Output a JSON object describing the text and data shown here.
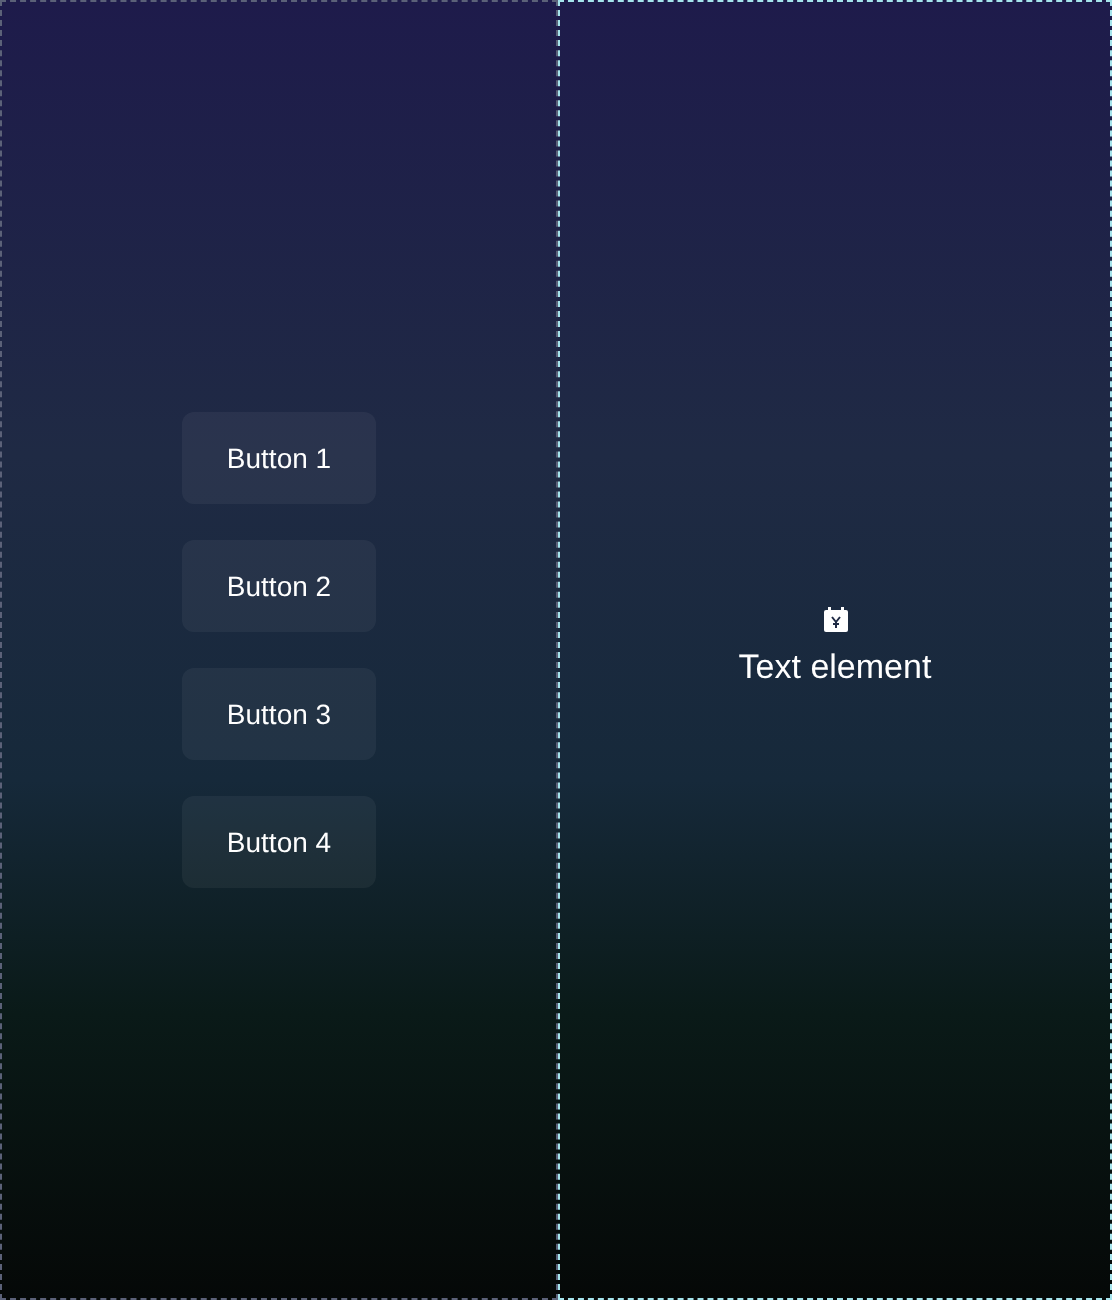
{
  "left_panel": {
    "buttons": [
      {
        "label": "Button 1"
      },
      {
        "label": "Button 2"
      },
      {
        "label": "Button 3"
      },
      {
        "label": "Button 4"
      }
    ]
  },
  "right_panel": {
    "text": "Text element"
  }
}
